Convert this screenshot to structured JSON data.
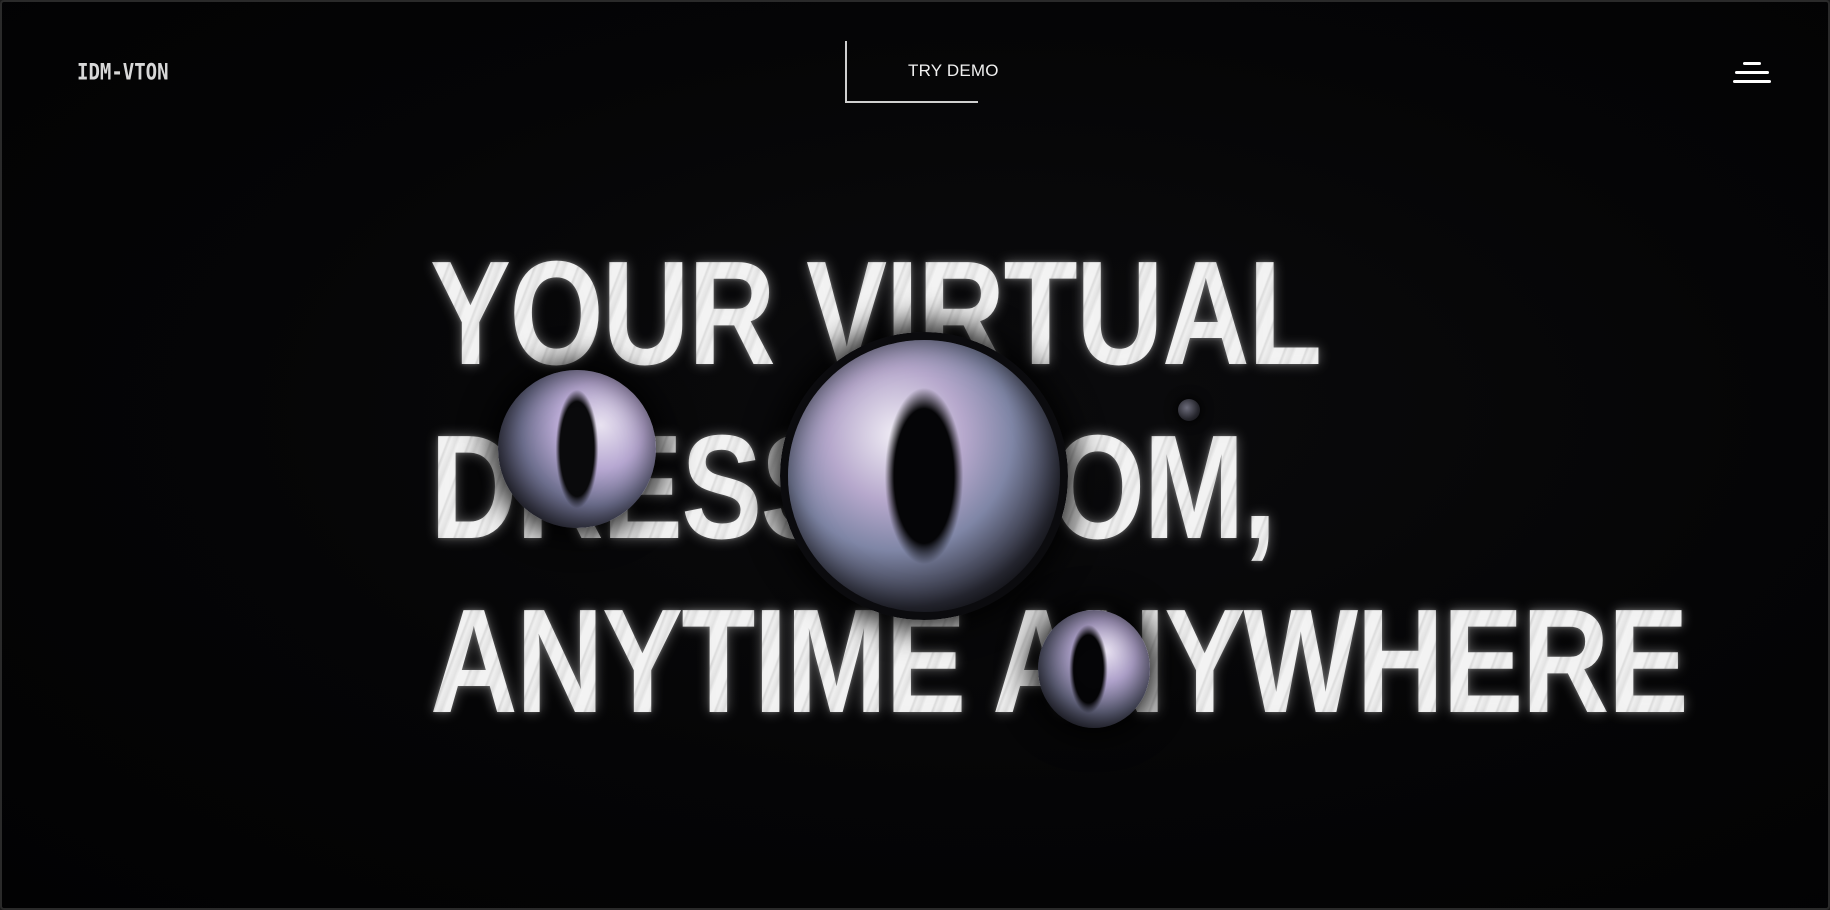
{
  "header": {
    "logo_text": "IDM-VTON",
    "demo_button_label": "TRY DEMO",
    "menu_icon": "hamburger-menu-icon"
  },
  "hero": {
    "lines": [
      "YOUR VIRTUAL",
      "DRESS ROOM,",
      "ANYTIME ANYWHERE"
    ]
  },
  "colors": {
    "background": "#050506",
    "text": "#e6e6e6",
    "accent_orb": "#b6a8cc"
  }
}
